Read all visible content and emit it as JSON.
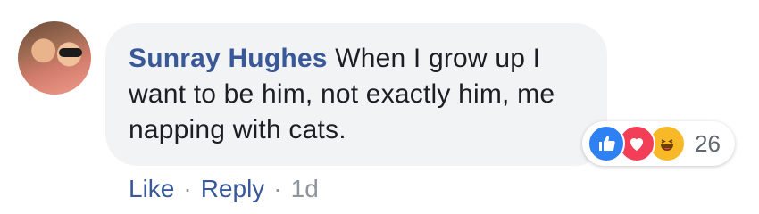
{
  "comment": {
    "author": "Sunray Hughes",
    "text": "When I grow up I want to be him, not exactly him, me napping with cats."
  },
  "reactions": {
    "types": [
      "like-icon",
      "love-icon",
      "haha-icon"
    ],
    "count": "26",
    "colors": {
      "like": "#2f80f2",
      "love": "#f33e58",
      "haha": "#f7b928"
    }
  },
  "actions": {
    "like_label": "Like",
    "separator": "·",
    "reply_label": "Reply",
    "timestamp": "1d"
  },
  "colors": {
    "link": "#385898",
    "bubble": "#f2f3f5",
    "meta": "#90949c"
  }
}
